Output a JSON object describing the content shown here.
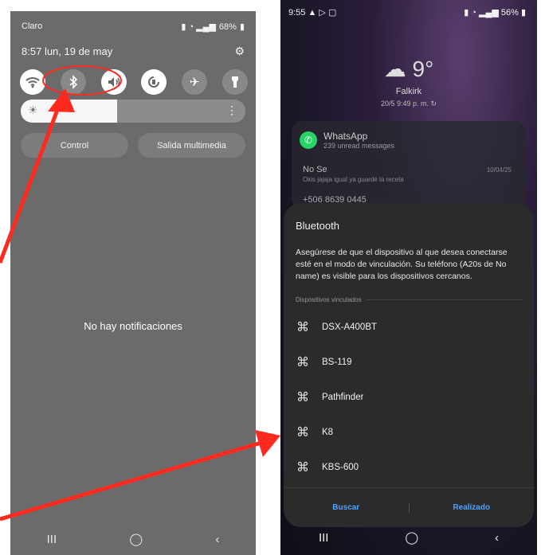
{
  "left_screen": {
    "status": {
      "carrier": "Claro",
      "battery": "68%"
    },
    "clock": {
      "time": "8:57",
      "date": "lun, 19 de may"
    },
    "quick_settings": [
      "wifi-icon",
      "bluetooth-icon",
      "sound-icon",
      "rotation-icon",
      "airplane-icon",
      "flashlight-icon"
    ],
    "buttons": {
      "control": "Control",
      "media_output": "Salida multimedia"
    },
    "empty_message": "No hay notificaciones"
  },
  "right_screen": {
    "status": {
      "time": "9:55",
      "battery": "56%"
    },
    "weather": {
      "temp": "9°",
      "city": "Falkirk",
      "updated": "20/5 9:49 p. m."
    },
    "whatsapp": {
      "app": "WhatsApp",
      "subtitle": "239 unread messages",
      "message_from": "No Se",
      "message_text": "Okis jajaja igual ya guardé la receta",
      "message_time": "10/04/25",
      "message_partial": "+506 8639 0445"
    },
    "bluetooth": {
      "title": "Bluetooth",
      "description": "Asegúrese de que el dispositivo al que desea conectarse esté en el modo de vinculación. Su teléfono (A20s de No name) es visible para los dispositivos cercanos.",
      "section_label": "Dispositivos vinculados",
      "devices": [
        "DSX-A400BT",
        "BS-119",
        "Pathfinder",
        "K8",
        "KBS-600"
      ],
      "scan_label": "Buscar",
      "done_label": "Realizado"
    }
  },
  "colors": {
    "accent_red": "#ff2a1f",
    "link_blue": "#4da3ff",
    "whatsapp_green": "#25d366"
  }
}
